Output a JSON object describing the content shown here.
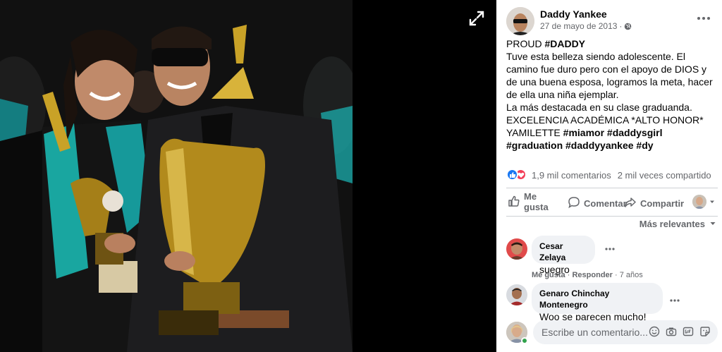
{
  "post": {
    "author": "Daddy Yankee",
    "date": "27 de mayo de 2013",
    "meta_separator": "·",
    "audience_icon": "globe-icon",
    "body_lines": [
      [
        {
          "t": "PROUD "
        },
        {
          "t": "#DADDY",
          "tag": true
        }
      ],
      [
        {
          "t": "Tuve esta belleza siendo adolescente. El camino fue duro pero con el apoyo de DIOS y de una buena esposa, logramos la meta, hacer de ella una niña ejemplar."
        }
      ],
      [
        {
          "t": "La más destacada en su clase graduanda."
        }
      ],
      [
        {
          "t": "EXCELENCIA ACADÉMICA *ALTO HONOR* YAMILETTE "
        },
        {
          "t": "#miamor",
          "tag": true
        },
        {
          "t": " "
        },
        {
          "t": "#daddysgirl",
          "tag": true
        },
        {
          "t": " "
        },
        {
          "t": "#graduation",
          "tag": true
        },
        {
          "t": " "
        },
        {
          "t": "#daddyyankee",
          "tag": true
        },
        {
          "t": " "
        },
        {
          "t": "#dy",
          "tag": true
        }
      ]
    ]
  },
  "stats": {
    "reaction_icons": [
      "like-icon",
      "love-icon"
    ],
    "comments": "1,9 mil comentarios",
    "shares": "2 mil veces compartido"
  },
  "actions": {
    "like": "Me gusta",
    "comment": "Comentar",
    "share": "Compartir"
  },
  "sort_label": "Más relevantes",
  "comments": [
    {
      "name": "Cesar Zelaya",
      "text": "suegro",
      "like": "Me gusta",
      "reply": "Responder",
      "time": "7 años"
    },
    {
      "name": "Genaro Chinchay Montenegro",
      "text": "Woo se parecen mucho!"
    }
  ],
  "composer": {
    "placeholder": "Escribe un comentario..."
  },
  "colors": {
    "link_blue": "#1877f2",
    "secondary_text": "#65676b",
    "bubble_bg": "#f0f2f5",
    "love_red": "#f33e58",
    "online_green": "#31a24c"
  }
}
